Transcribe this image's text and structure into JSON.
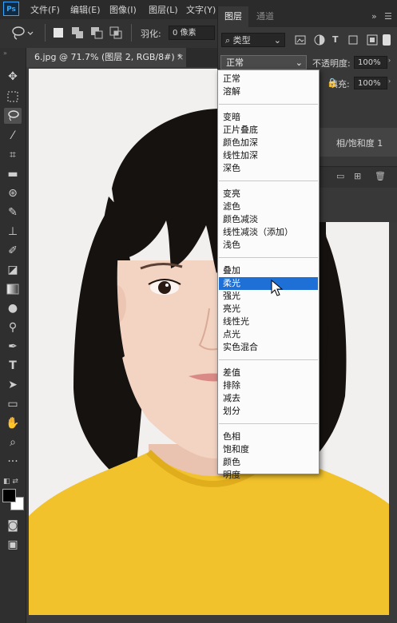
{
  "app": {
    "logo": "Ps"
  },
  "menubar": {
    "items": [
      "文件(F)",
      "编辑(E)",
      "图像(I)",
      "图层(L)",
      "文字(Y)"
    ]
  },
  "options": {
    "feather_label": "羽化:",
    "feather_value": "0 像素"
  },
  "document": {
    "tab_title": "6.jpg @ 71.7% (图层 2, RGB/8#) *",
    "close": "×"
  },
  "panel": {
    "tabs": [
      "图层",
      "通道"
    ],
    "kind_filter": "类型",
    "blend_mode": "正常",
    "opacity_label": "不透明度:",
    "opacity_value": "100%",
    "fill_label": "填充:",
    "fill_value": "100%",
    "layer_name_partial": "相/饱和度 1",
    "more": "»"
  },
  "blend_menu": {
    "groups": [
      [
        "正常",
        "溶解"
      ],
      [
        "变暗",
        "正片叠底",
        "颜色加深",
        "线性加深",
        "深色"
      ],
      [
        "变亮",
        "滤色",
        "颜色减淡",
        "线性减淡（添加）",
        "浅色"
      ],
      [
        "叠加",
        "柔光",
        "强光",
        "亮光",
        "线性光",
        "点光",
        "实色混合"
      ],
      [
        "差值",
        "排除",
        "减去",
        "划分"
      ],
      [
        "色相",
        "饱和度",
        "颜色",
        "明度"
      ]
    ],
    "selected": "柔光"
  },
  "colors": {
    "menu_highlight": "#1e6fd6",
    "shirt_yellow": "#f2c22c",
    "hair": "#161210",
    "skin": "#f3d3c2",
    "canvas_bg": "#f1f0ee",
    "ps_blue": "#31a8ff"
  },
  "icons": {
    "tools": [
      "move-icon",
      "marquee-icon",
      "lasso-icon",
      "magic-wand-icon",
      "crop-icon",
      "ruler-icon",
      "patch-icon",
      "brush-icon",
      "stamp-icon",
      "history-brush-icon",
      "eraser-icon",
      "gradient-icon",
      "blur-icon",
      "dodge-icon",
      "pen-icon",
      "type-icon",
      "path-select-icon",
      "rectangle-icon",
      "hand-icon",
      "zoom-icon",
      "more-tools-icon"
    ]
  }
}
